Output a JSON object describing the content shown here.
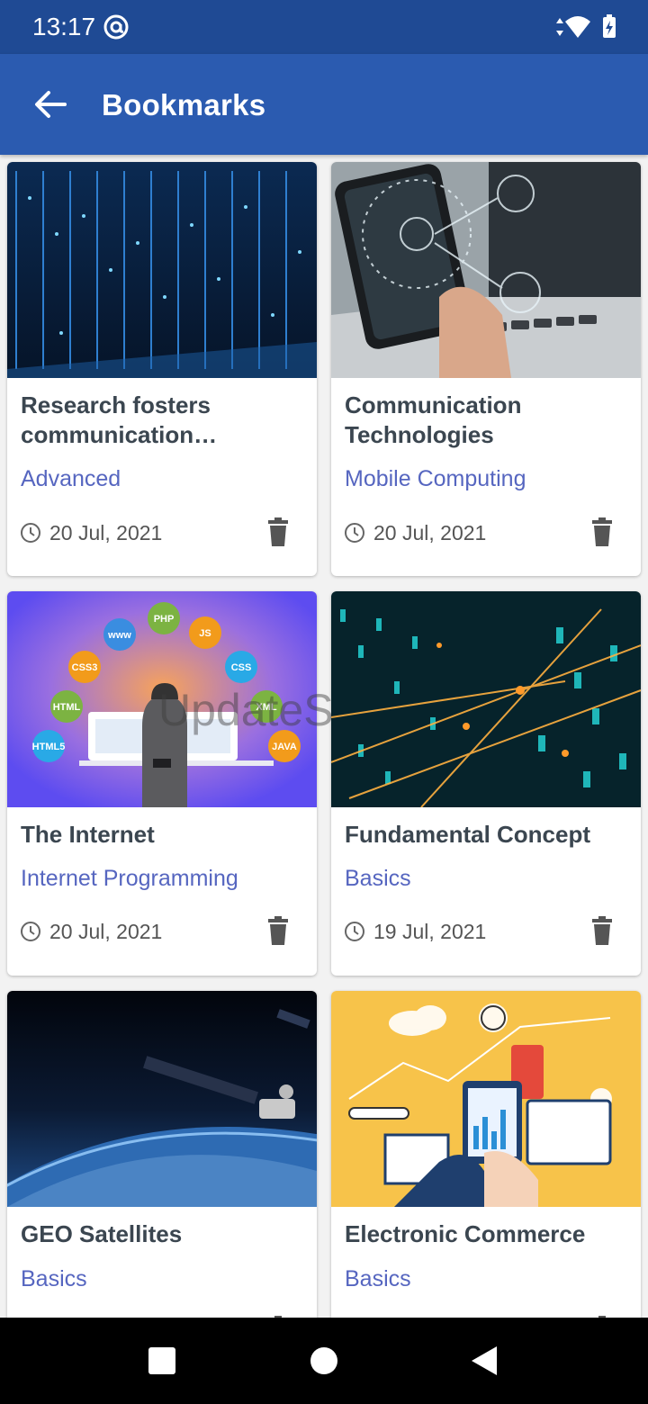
{
  "status_bar": {
    "time": "13:17",
    "icons": [
      "at-sign-icon",
      "data-arrows-icon",
      "wifi-icon",
      "battery-charging-icon"
    ]
  },
  "app_bar": {
    "title": "Bookmarks",
    "back_icon": "arrow-left-icon"
  },
  "cards": [
    {
      "title": "Research fosters communication between...",
      "category": "Advanced",
      "date": "20 Jul, 2021"
    },
    {
      "title": "Communication Technologies",
      "category": "Mobile Computing",
      "date": "20 Jul, 2021"
    },
    {
      "title": "The Internet",
      "category": "Internet Programming",
      "date": "20 Jul, 2021"
    },
    {
      "title": "Fundamental Concept",
      "category": "Basics",
      "date": "19 Jul, 2021"
    },
    {
      "title": "GEO Satellites",
      "category": "Basics",
      "date": ""
    },
    {
      "title": "Electronic Commerce",
      "category": "Basics",
      "date": ""
    }
  ],
  "watermark": "UpdateS",
  "colors": {
    "status_bar": "#1f4a94",
    "app_bar": "#2b5bb0",
    "category": "#5666c0",
    "title": "#3b4650"
  }
}
